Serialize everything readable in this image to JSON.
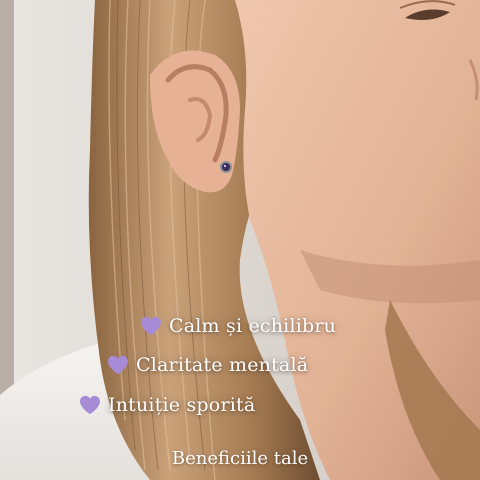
{
  "colors": {
    "heart": "#a78bd6",
    "text": "#ffffff",
    "skin": "#e3b79c",
    "hair": "#b58a5c",
    "shirt": "#f3f1ee",
    "wall": "#d9d2cb"
  },
  "benefits": [
    {
      "icon": "purple-heart-icon",
      "label": "Calm și echilibru"
    },
    {
      "icon": "purple-heart-icon",
      "label": "Claritate mentală"
    },
    {
      "icon": "purple-heart-icon",
      "label": "Intuiție sporită"
    }
  ],
  "caption": "Beneficiile tale"
}
